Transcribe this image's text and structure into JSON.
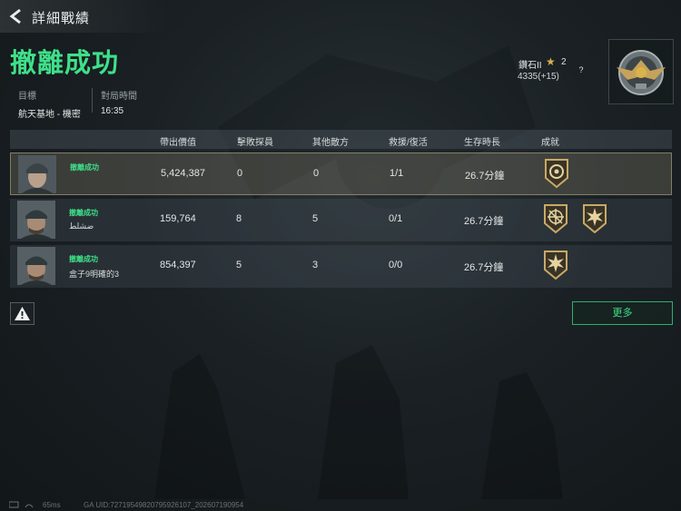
{
  "header": {
    "title": "詳細戰績"
  },
  "result": {
    "headline": "撤離成功"
  },
  "meta": [
    {
      "label": "目標",
      "value": "航天基地 - 機密"
    },
    {
      "label": "對局時間",
      "value": "16:35"
    }
  ],
  "rank": {
    "name": "鑽石II",
    "level": "2",
    "points": "4335(+15)",
    "help": "?"
  },
  "table": {
    "headers": [
      "帶出價值",
      "擊敗探員",
      "其他敵方",
      "救援/復活",
      "生存時長",
      "成就"
    ],
    "rows": [
      {
        "status": "撤離成功",
        "name": "",
        "value": "5,424,387",
        "kills": "0",
        "other": "0",
        "rescue": "1/1",
        "time": "26.7分鐘",
        "badges": [
          "gear-badge"
        ]
      },
      {
        "status": "撤離成功",
        "name": "ضشلط",
        "value": "159,764",
        "kills": "8",
        "other": "5",
        "rescue": "0/1",
        "time": "26.7分鐘",
        "badges": [
          "crosshair-badge",
          "burst-badge"
        ]
      },
      {
        "status": "撤離成功",
        "name": "盒子9明確的3",
        "value": "854,397",
        "kills": "5",
        "other": "3",
        "rescue": "0/0",
        "time": "26.7分鐘",
        "badges": [
          "burst-badge"
        ]
      }
    ]
  },
  "buttons": {
    "more": "更多"
  },
  "footer": {
    "ping": "65ms",
    "uid": "GA UID:7271954982079592​6107_202607190954"
  },
  "colors": {
    "accent": "#3fe089",
    "gold": "#d9b24a"
  }
}
